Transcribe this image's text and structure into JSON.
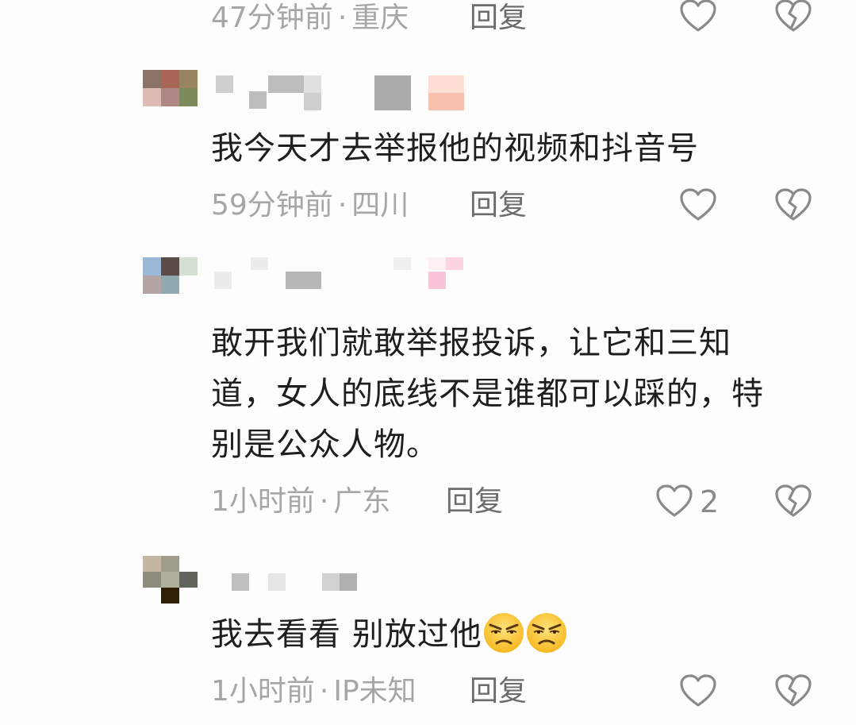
{
  "comments": [
    {
      "time": "47分钟前",
      "location": "重庆",
      "reply_label": "回复"
    },
    {
      "text": "我今天才去举报他的视频和抖音号",
      "time": "59分钟前",
      "location": "四川",
      "reply_label": "回复"
    },
    {
      "text_lines": [
        "敢开我们就敢举报投诉，让它和三知",
        "道，女人的底线不是谁都可以踩的，特",
        "别是公众人物。"
      ],
      "time": "1小时前",
      "location": "广东",
      "reply_label": "回复",
      "like_count": "2"
    },
    {
      "text": "我去看看 别放过他",
      "emojis": [
        "unamused-face-emoji",
        "unamused-face-emoji"
      ],
      "time": "1小时前",
      "location": "IP未知",
      "reply_label": "回复"
    }
  ],
  "separator": "·",
  "colors": {
    "text": "#1e1e1e",
    "meta": "#a6a6a6",
    "reply": "#6c6c6c",
    "icon": "#8a8a8a",
    "background": "#fdfdfd"
  }
}
